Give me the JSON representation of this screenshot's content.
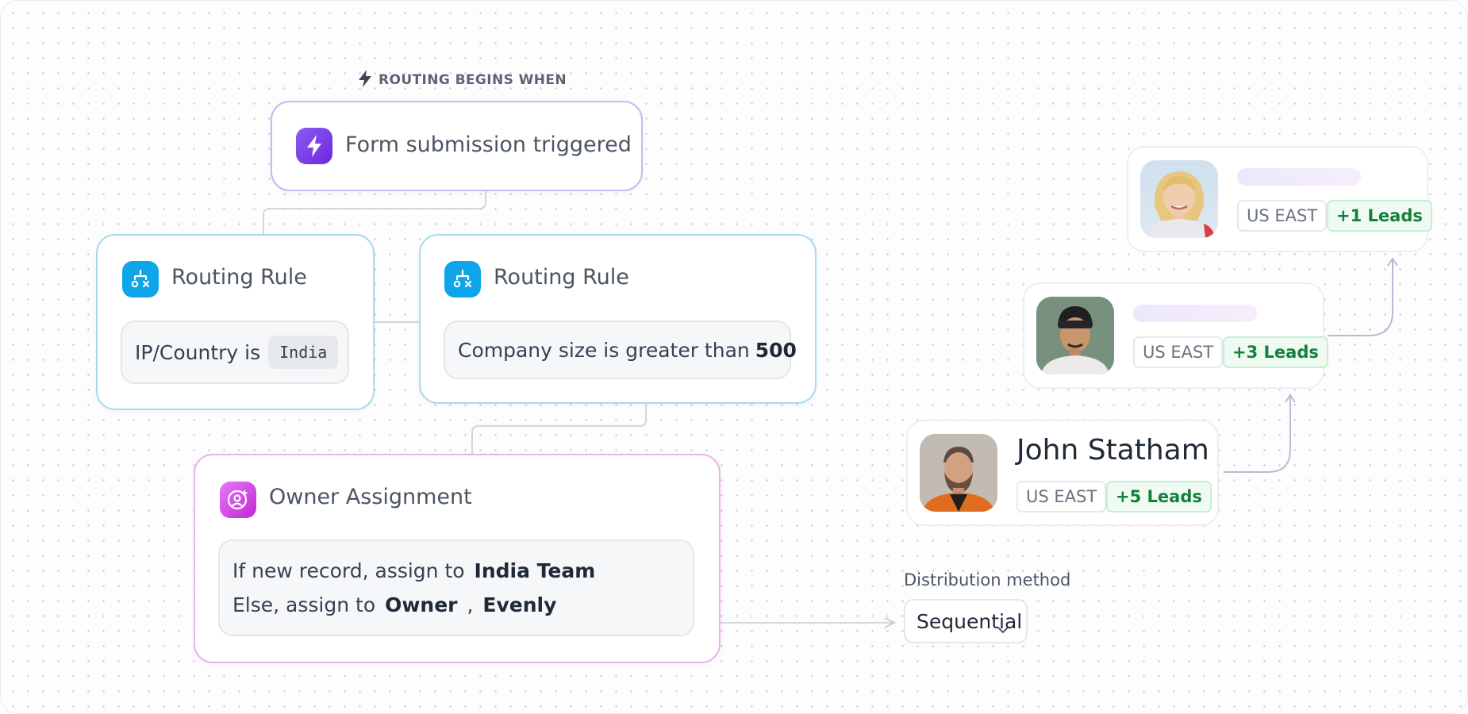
{
  "trigger": {
    "header_label": "ROUTING BEGINS WHEN",
    "title": "Form submission triggered"
  },
  "routing_rules": [
    {
      "title": "Routing Rule",
      "condition_text": "IP/Country is",
      "condition_value": "India"
    },
    {
      "title": "Routing Rule",
      "condition_text": "Company size is greater than",
      "condition_value": "500"
    }
  ],
  "owner_assignment": {
    "title": "Owner Assignment",
    "line1_text": "If new record, assign to",
    "line1_value": "India Team",
    "line2_text": "Else, assign to",
    "line2_owner": "Owner",
    "line2_sep": ",",
    "line2_method": "Evenly"
  },
  "distribution": {
    "label": "Distribution method",
    "selected": "Sequential"
  },
  "people": [
    {
      "name": "",
      "region": "US EAST",
      "leads": "+1 Leads"
    },
    {
      "name": "",
      "region": "US EAST",
      "leads": "+3 Leads"
    },
    {
      "name": "John Statham",
      "region": "US EAST",
      "leads": "+5 Leads"
    }
  ],
  "colors": {
    "trigger_accent": "#7c4dff",
    "routing_accent": "#0ea5e9",
    "owner_accent": "#d946ef",
    "leads_green": "#15803d"
  },
  "icons": {
    "trigger_header": "lightning-icon",
    "trigger": "lightning-icon",
    "routing_rule": "routing-split-icon",
    "owner_assignment": "user-plus-icon",
    "select": "chevron-down-icon"
  }
}
